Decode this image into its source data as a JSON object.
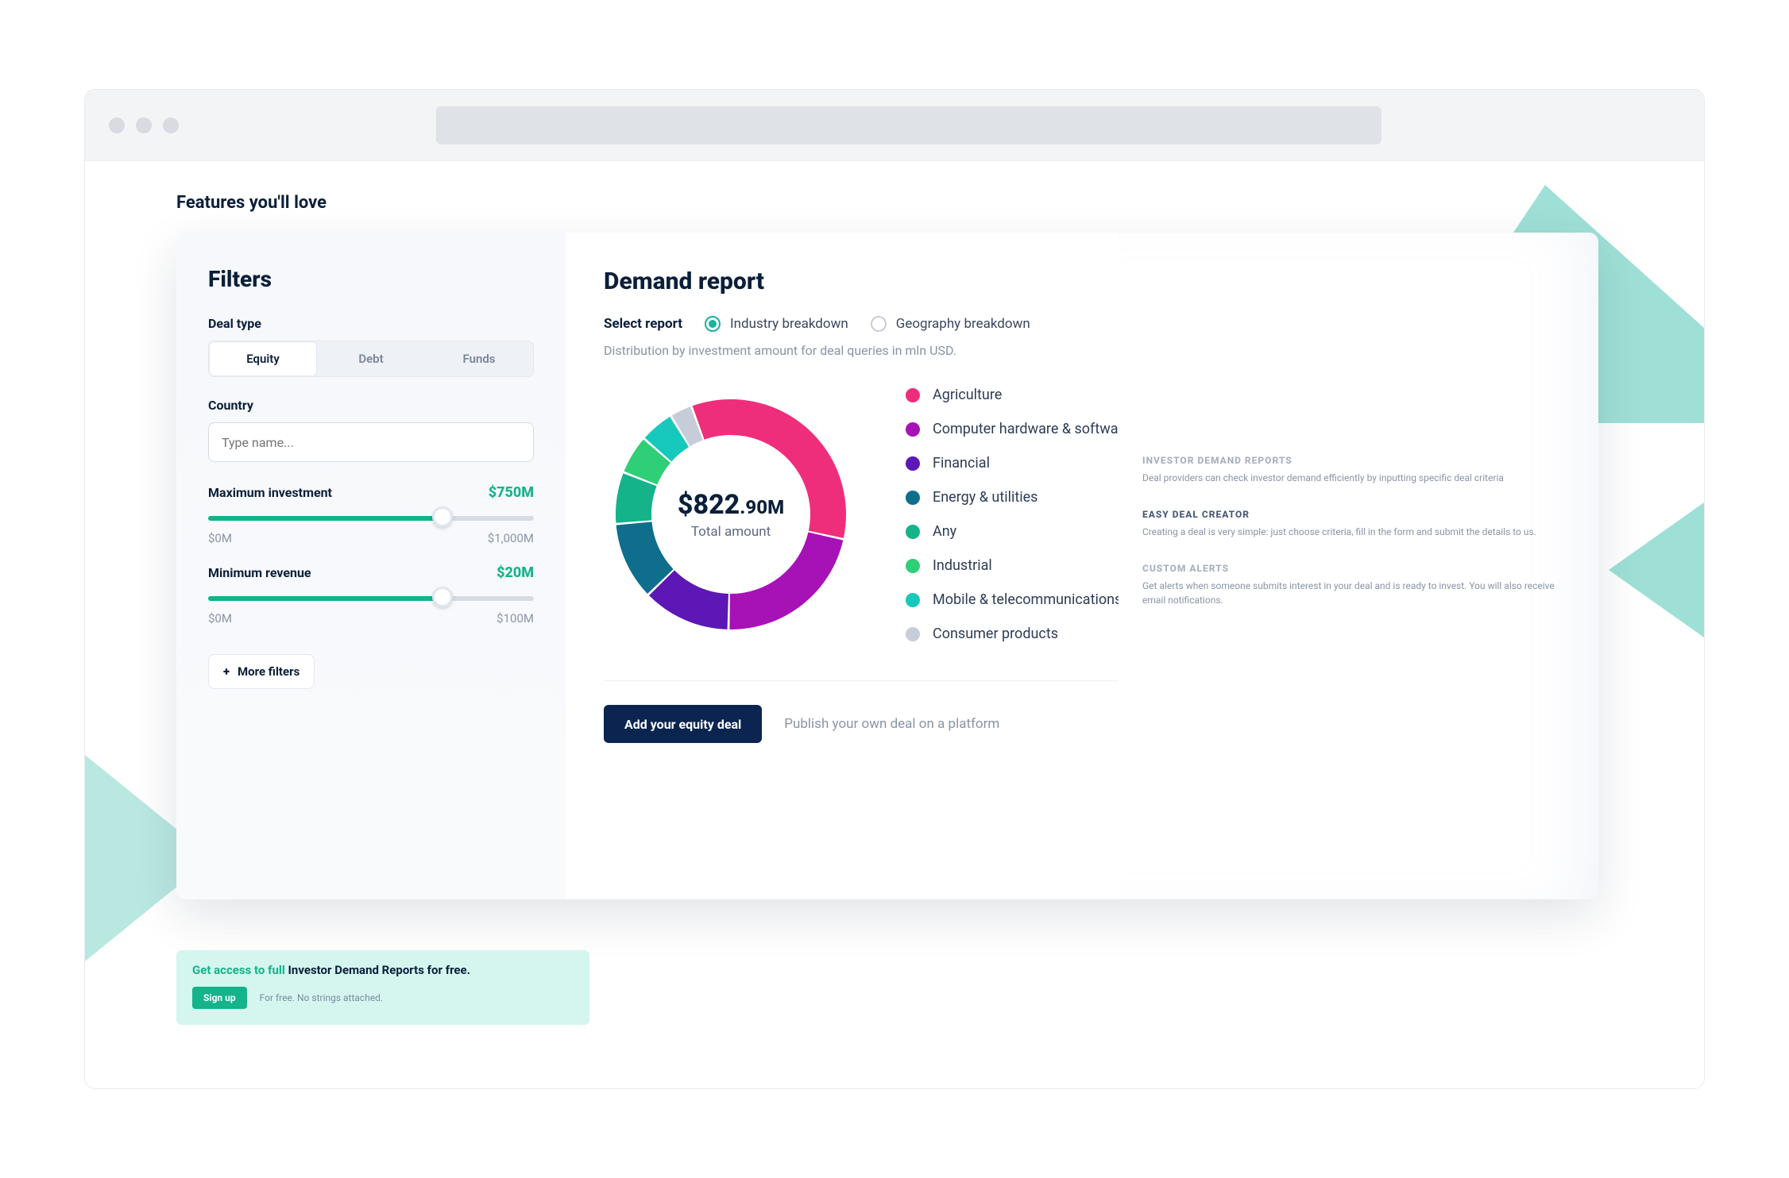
{
  "headline": "Features you'll love",
  "filters": {
    "title": "Filters",
    "deal_type_label": "Deal type",
    "tabs": {
      "equity": "Equity",
      "debt": "Debt",
      "funds": "Funds"
    },
    "country_label": "Country",
    "country_placeholder": "Type name...",
    "max_invest": {
      "label": "Maximum investment",
      "value": "$750M",
      "min": "$0M",
      "max": "$1,000M",
      "pct": 72
    },
    "min_revenue": {
      "label": "Minimum revenue",
      "value": "$20M",
      "min": "$0M",
      "max": "$100M",
      "pct": 72
    },
    "more_filters": "More filters"
  },
  "report": {
    "title": "Demand report",
    "select_label": "Select report",
    "options": {
      "industry": "Industry breakdown",
      "geography": "Geography breakdown"
    },
    "subtitle": "Distribution by investment amount for deal queries in mln USD.",
    "total_label": "Total amount",
    "total_int": "$822",
    "total_dec": ".90M",
    "cta_button": "Add your equity deal",
    "cta_text": "Publish your own deal on a platform"
  },
  "chart_data": {
    "type": "pie",
    "title": "Distribution by investment amount for deal queries in mln USD.",
    "total": 822.9,
    "unit": "mln USD",
    "series": [
      {
        "name": "Agriculture",
        "value": 280,
        "color": "#ef2e7b"
      },
      {
        "name": "Computer hardware & software",
        "value": 180,
        "color": "#a712b7"
      },
      {
        "name": "Financial",
        "value": 102,
        "color": "#5d17b5"
      },
      {
        "name": "Energy & utilities",
        "value": 90,
        "color": "#0e6e8c"
      },
      {
        "name": "Any",
        "value": 60,
        "color": "#14b38a"
      },
      {
        "name": "Industrial",
        "value": 45,
        "color": "#2ecf76"
      },
      {
        "name": "Mobile & telecommunications",
        "value": 40,
        "color": "#17c8bc"
      },
      {
        "name": "Consumer products",
        "value": 25.9,
        "color": "#c7cdd8"
      }
    ]
  },
  "features": [
    {
      "title": "INVESTOR DEMAND REPORTS",
      "desc": "Deal providers can check investor demand efficiently by inputting specific deal criteria"
    },
    {
      "title": "EASY DEAL CREATOR",
      "desc": "Creating a deal is very simple: just choose criteria, fill in the form and submit the details to us."
    },
    {
      "title": "CUSTOM ALERTS",
      "desc": "Get alerts when someone submits interest in your deal and is ready to invest. You will also receive email notifications."
    }
  ],
  "promo": {
    "lead_teal": "Get access to full ",
    "lead_bold": "Investor Demand Reports for free.",
    "signup": "Sign up",
    "sub": "For free. No strings attached."
  }
}
